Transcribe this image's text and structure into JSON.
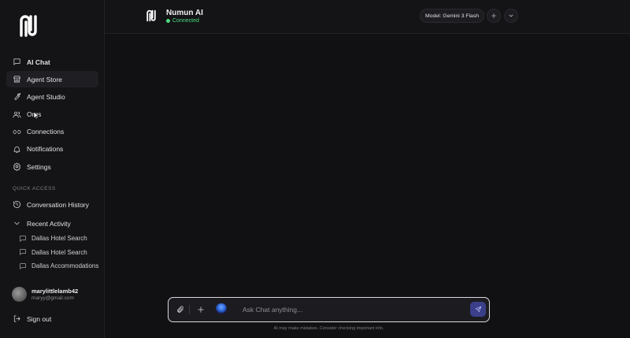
{
  "app": {
    "name": "Numun AI",
    "status": "Connected",
    "status_color": "#4ade80",
    "accent": "#3b3f8a"
  },
  "sidebar": {
    "nav": [
      {
        "label": "AI Chat",
        "icon": "message-square-icon"
      },
      {
        "label": "Agent Store",
        "icon": "store-icon"
      },
      {
        "label": "Agent Studio",
        "icon": "wrench-icon"
      },
      {
        "label": "Orgs",
        "icon": "users-icon"
      },
      {
        "label": "Connections",
        "icon": "link-icon"
      },
      {
        "label": "Notifications",
        "icon": "bell-icon"
      },
      {
        "label": "Settings",
        "icon": "gear-icon"
      }
    ],
    "quick_access_label": "QUICK ACCESS",
    "conversation_history": "Conversation History",
    "recent_activity": "Recent Activity",
    "recent_items": [
      "Dallas Hotel Search",
      "Dallas Hotel Search",
      "Dallas Accommodations"
    ],
    "user": {
      "name": "marylittlelamb42",
      "email": "maryy@gmail.com"
    },
    "sign_out": "Sign out"
  },
  "header": {
    "model_label": "Model: Gemini 3 Flash"
  },
  "composer": {
    "placeholder": "Ask Chat anything...",
    "disclaimer": "AI may make mistakes. Consider checking important info."
  }
}
